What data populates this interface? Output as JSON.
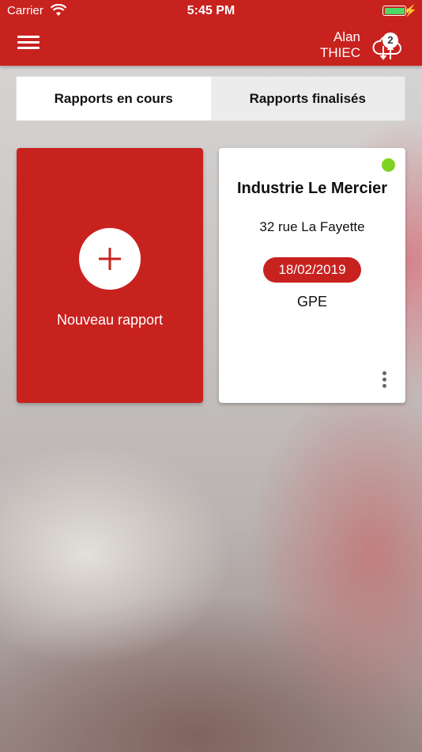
{
  "status_bar": {
    "carrier": "Carrier",
    "time": "5:45 PM",
    "battery_level": 1.0
  },
  "header": {
    "user_first_name": "Alan",
    "user_last_name": "THIEC",
    "sync_badge_count": "2",
    "accent_color": "#c8221f"
  },
  "tabs": [
    {
      "label": "Rapports en cours",
      "active": true
    },
    {
      "label": "Rapports finalisés",
      "active": false
    }
  ],
  "new_report": {
    "label": "Nouveau rapport"
  },
  "reports": [
    {
      "title": "Industrie Le Mercier",
      "address": "32 rue La Fayette",
      "date": "18/02/2019",
      "code": "GPE",
      "status_color": "#7ed321"
    }
  ]
}
